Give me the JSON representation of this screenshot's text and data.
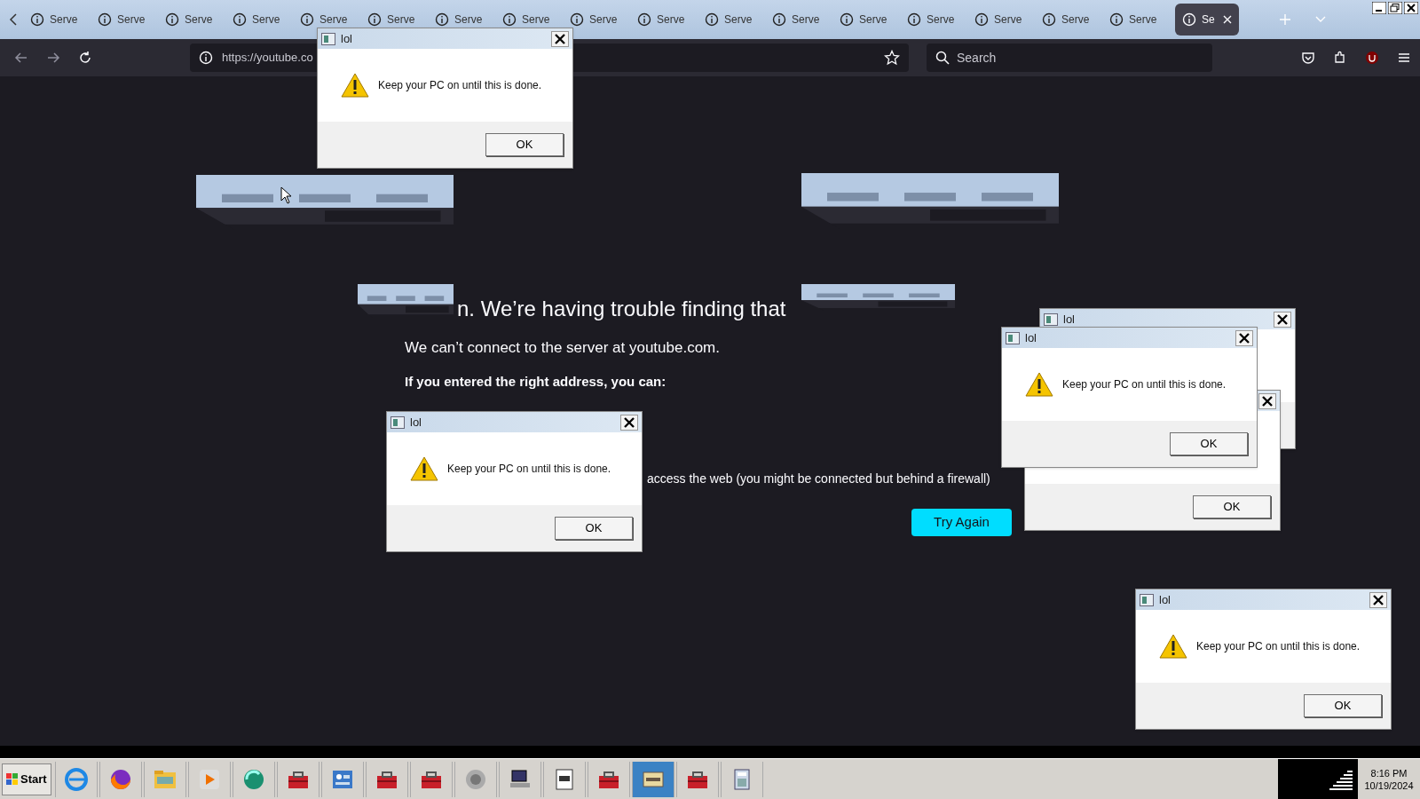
{
  "tabs": [
    {
      "label": "Serve",
      "selected": false
    },
    {
      "label": "Serve",
      "selected": false
    },
    {
      "label": "Serve",
      "selected": false
    },
    {
      "label": "Serve",
      "selected": false
    },
    {
      "label": "Serve",
      "selected": false
    },
    {
      "label": "Serve",
      "selected": false
    },
    {
      "label": "Serve",
      "selected": false
    },
    {
      "label": "Serve",
      "selected": false
    },
    {
      "label": "Serve",
      "selected": false
    },
    {
      "label": "Serve",
      "selected": false
    },
    {
      "label": "Serve",
      "selected": false
    },
    {
      "label": "Serve",
      "selected": false
    },
    {
      "label": "Serve",
      "selected": false
    },
    {
      "label": "Serve",
      "selected": false
    },
    {
      "label": "Serve",
      "selected": false
    },
    {
      "label": "Serve",
      "selected": false
    },
    {
      "label": "Serve",
      "selected": false
    },
    {
      "label": "Se",
      "selected": true
    }
  ],
  "toolbar": {
    "url": "https://youtube.co",
    "search_placeholder": "Search"
  },
  "error_page": {
    "heading": "n. We’re having trouble finding that",
    "message": "We can’t connect to the server at youtube.com.",
    "subheading": "If you entered the right address, you can:",
    "list_item": "access the web (you might be connected but behind a firewall)",
    "button": "Try Again"
  },
  "dialogs": [
    {
      "title": "lol",
      "message": "Keep your PC on until this is done.",
      "button": "OK"
    },
    {
      "title": "lol"
    },
    {
      "button": "OK"
    },
    {
      "title": "lol",
      "message": "Keep your PC on until this is done.",
      "button": "OK"
    },
    {
      "title": "lol",
      "message": "Keep your PC on until this is done.",
      "button": "OK"
    },
    {
      "title": "lol",
      "message": "Keep your PC on until this is done.",
      "button": "OK"
    }
  ],
  "taskbar": {
    "start": "Start",
    "time": "8:16 PM",
    "date": "10/19/2024"
  }
}
